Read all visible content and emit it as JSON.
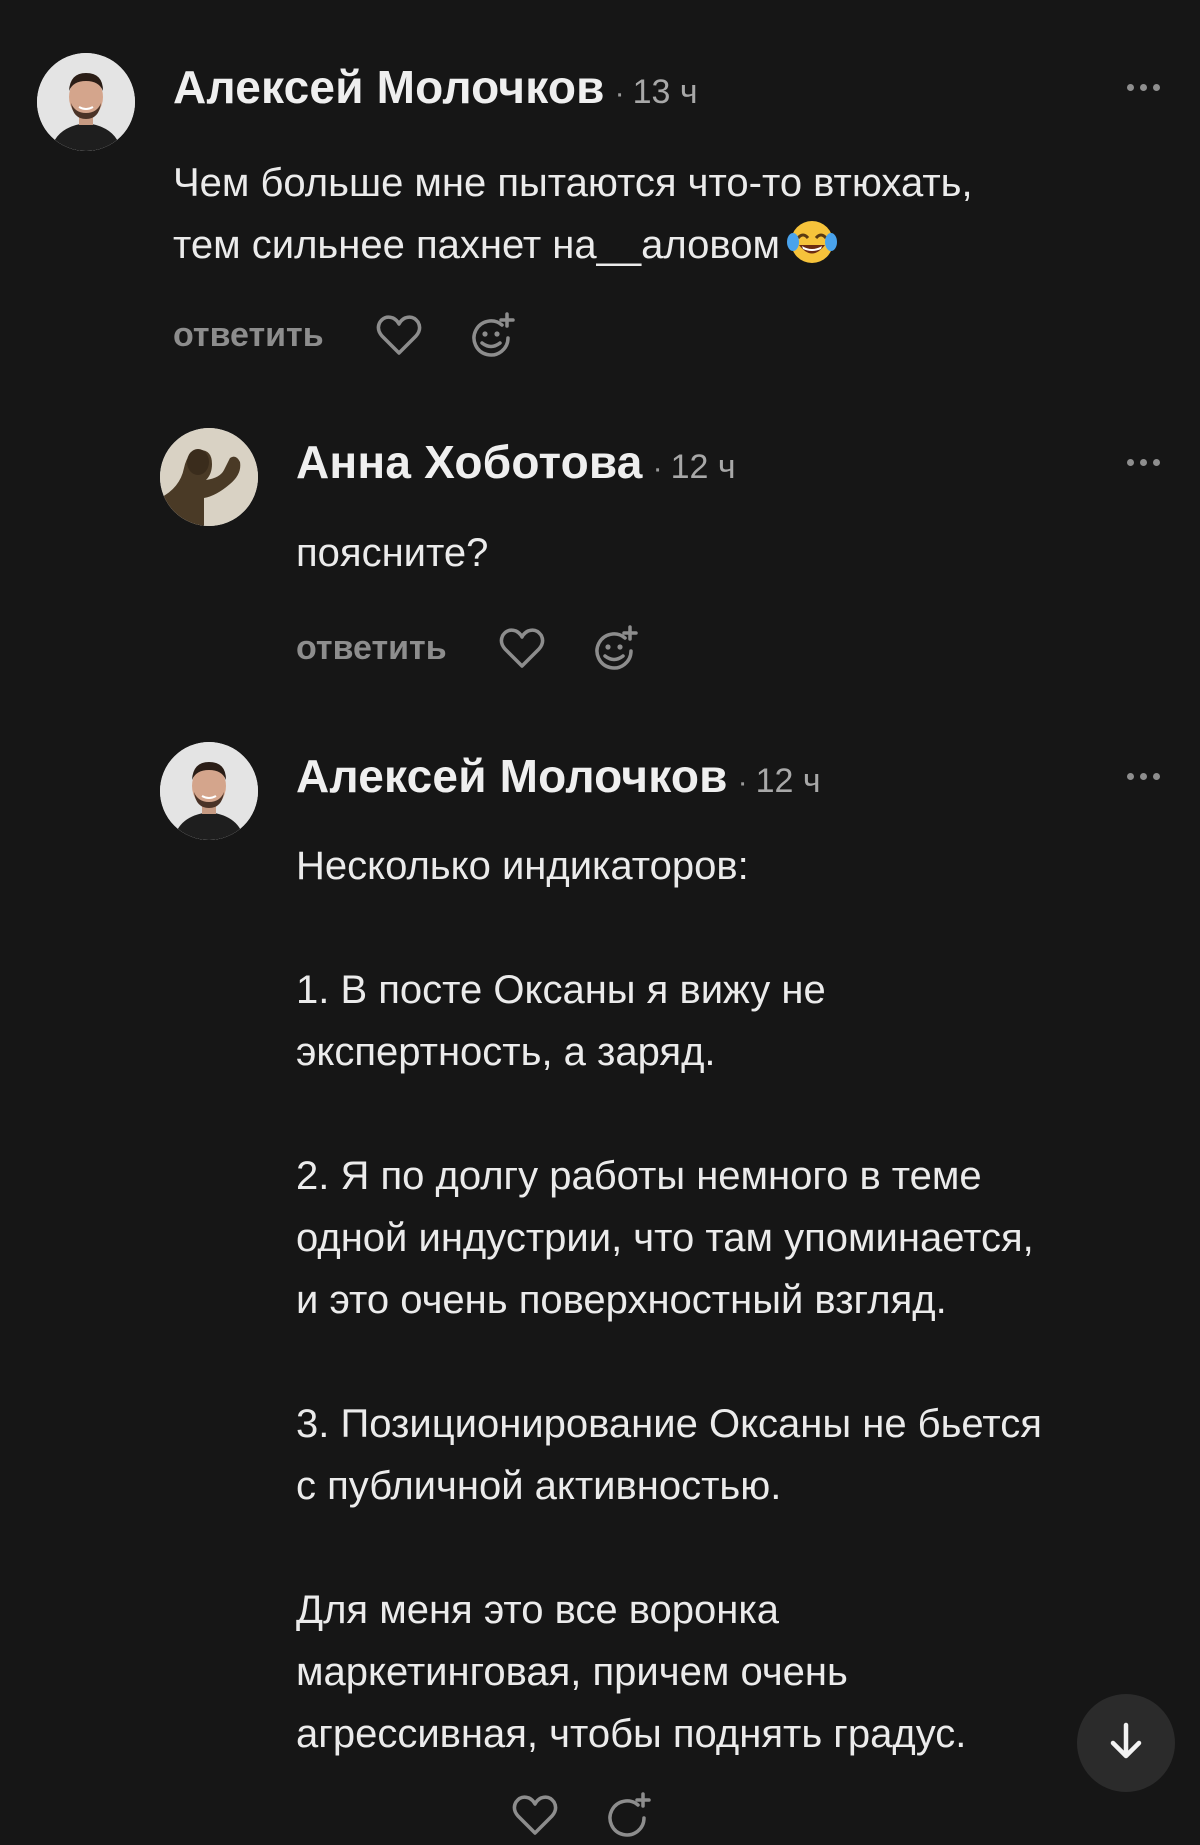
{
  "comments": [
    {
      "author": "Алексей Молочков",
      "separator": "·",
      "time": "13 ч",
      "lines": [
        "Чем больше мне пытаются что-то втюхать,",
        "тем сильнее пахнет на__аловом"
      ],
      "emoji_icon": "face-with-tears-of-joy",
      "reply_label": "ответить"
    },
    {
      "author": "Анна Хоботова",
      "separator": "·",
      "time": "12 ч",
      "lines": [
        "поясните?"
      ],
      "reply_label": "ответить"
    },
    {
      "author": "Алексей Молочков",
      "separator": "·",
      "time": "12 ч",
      "paragraphs": [
        [
          "Несколько индикаторов:"
        ],
        [
          "1. В посте Оксаны я вижу не",
          "экспертность, а заряд."
        ],
        [
          "2. Я по долгу работы немного в теме",
          "одной индустрии, что там упоминается,",
          "и это очень поверхностный взгляд."
        ],
        [
          "3. Позиционирование Оксаны не бьется",
          "с публичной активностью."
        ],
        [
          "Для меня это все воронка",
          "маркетинговая, причем очень",
          "агрессивная, чтобы поднять градус."
        ]
      ]
    }
  ],
  "icons": {
    "like": "heart-icon",
    "react": "add-reaction-icon",
    "more": "more-dots-icon",
    "scroll": "arrow-down-icon"
  },
  "colors": {
    "background": "#161616",
    "text": "#ebebeb",
    "muted": "#8d8d8d"
  }
}
